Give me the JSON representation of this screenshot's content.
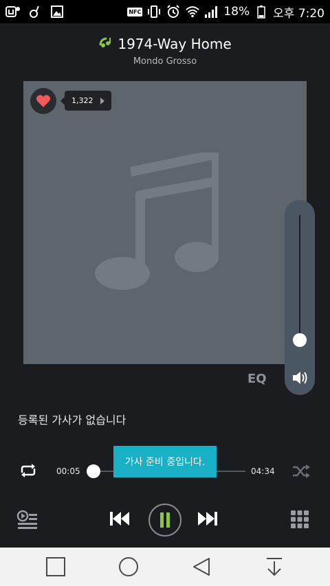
{
  "status_bar": {
    "battery": "18%",
    "time": "오후 7:20",
    "nfc": "NFC",
    "icons": [
      "cube-app-icon",
      "music-note-icon",
      "image-icon",
      "nfc-icon",
      "vibrate-icon",
      "alarm-icon",
      "wifi-icon",
      "signal-icon",
      "battery-icon"
    ]
  },
  "track": {
    "title": "1974-Way Home",
    "artist": "Mondo Grosso"
  },
  "album": {
    "like_count": "1,322",
    "icon": "music-note-icon"
  },
  "volume": {
    "level": 0.05
  },
  "eq_label": "EQ",
  "lyrics_text": "등록된 가사가 없습니다",
  "playback": {
    "current_time": "00:05",
    "total_time": "04:34",
    "progress": 0.02,
    "toast": "가사 준비 중입니다."
  },
  "colors": {
    "accent": "#8dc63f",
    "toast": "#19b0c6",
    "heart": "#ef5a5a",
    "background": "#1b1c20"
  }
}
